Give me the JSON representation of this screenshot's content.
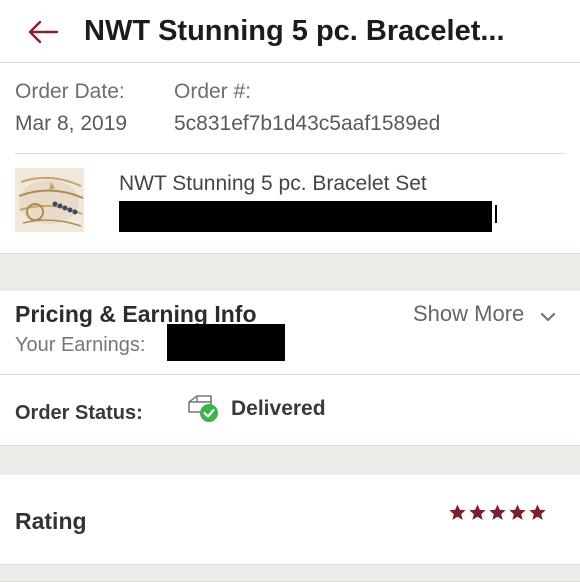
{
  "header": {
    "title": "NWT Stunning 5 pc. Bracelet..."
  },
  "order": {
    "date_label": "Order Date:",
    "date_value": "Mar 8, 2019",
    "number_label": "Order #:",
    "number_value": "5c831ef7b1d43c5aaf1589ed"
  },
  "item": {
    "title": "NWT Stunning 5 pc. Bracelet Set"
  },
  "pricing": {
    "title": "Pricing & Earning Info",
    "show_more_label": "Show More",
    "earnings_label": "Your Earnings:"
  },
  "status": {
    "label": "Order Status:",
    "value": "Delivered",
    "icon": "package-delivered-icon",
    "check_color": "#3bb54a"
  },
  "rating": {
    "label": "Rating",
    "stars": 5,
    "max_stars": 5,
    "star_color": "#7d1f2a"
  },
  "colors": {
    "accent": "#8b1f2c",
    "band": "#eeece8"
  }
}
